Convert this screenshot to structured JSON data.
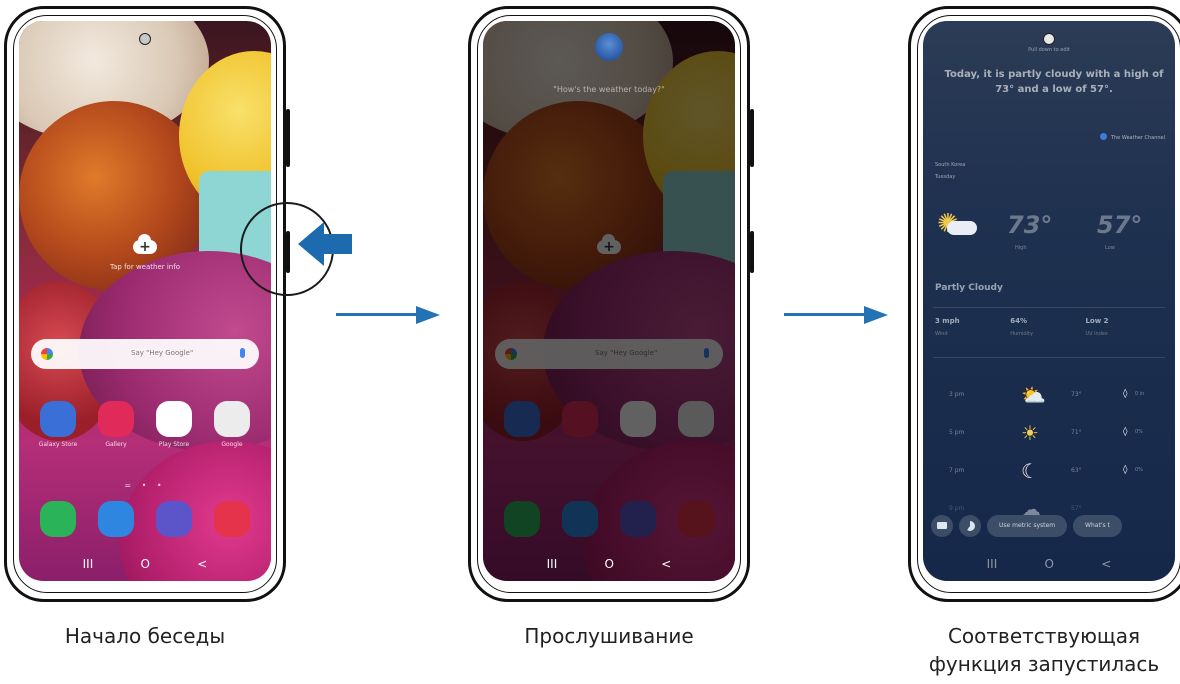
{
  "captions": {
    "step1": "Начало беседы",
    "step2": "Прослушивание",
    "step3_line1": "Соответствующая",
    "step3_line2": "функция запустилась"
  },
  "home_screen": {
    "weather_tip": "Tap for weather info",
    "search_hint": "Say \"Hey Google\"",
    "apps_row1": [
      "Galaxy Store",
      "Gallery",
      "Play Store",
      "Google"
    ],
    "apps_row2": [
      "Phone",
      "Messages",
      "Internet",
      "Camera"
    ],
    "page_dots": "= • •",
    "nav": [
      "III",
      "O",
      "<"
    ]
  },
  "listening_screen": {
    "query": "\"How's the weather today?\""
  },
  "weather_screen": {
    "hint": "Pull down to edit",
    "answer": "Today, it is partly cloudy with a high of 73° and a low of 57°.",
    "source": "The Weather Channel",
    "location": "South Korea",
    "day": "Tuesday",
    "high": "73°",
    "low": "57°",
    "high_label": "High",
    "low_label": "Low",
    "condition": "Partly Cloudy",
    "stats": [
      {
        "value": "3 mph",
        "label": "Wind"
      },
      {
        "value": "64%",
        "label": "Humidity"
      },
      {
        "value": "Low 2",
        "label": "UV index"
      }
    ],
    "hourly": [
      {
        "time": "3 pm",
        "icon": "partly-cloudy-icon",
        "temp": "73°",
        "precip": "0 in"
      },
      {
        "time": "5 pm",
        "icon": "sun-cloud-icon",
        "temp": "71°",
        "precip": "0%"
      },
      {
        "time": "7 pm",
        "icon": "moon-icon",
        "temp": "63°",
        "precip": "0%"
      },
      {
        "time": "9 pm",
        "icon": "cloud-night-icon",
        "temp": "57°",
        "precip": "0%"
      }
    ],
    "chip_metric": "Use metric system",
    "chip_more": "What's t"
  },
  "colors": {
    "arrow": "#2272b4",
    "callout_arrow": "#1e6aaf"
  }
}
